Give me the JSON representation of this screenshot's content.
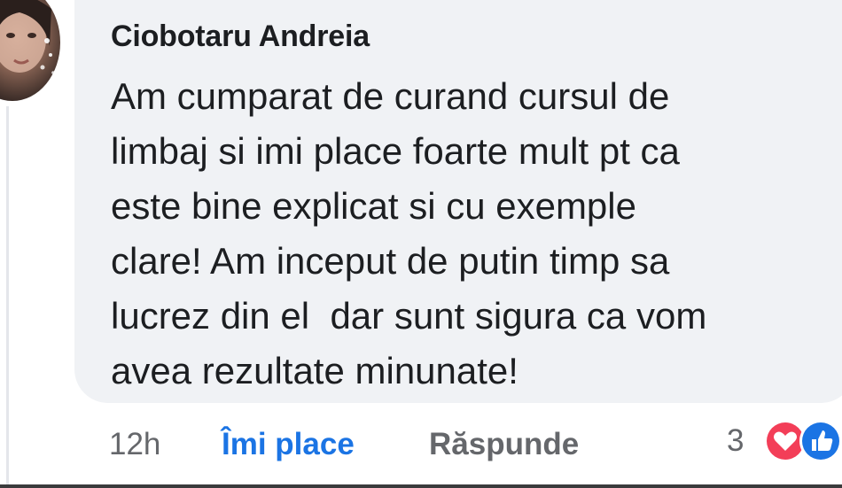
{
  "comment": {
    "author": "Ciobotaru Andreia",
    "text_lines": [
      "Am cumparat de curand cursul de",
      "limbaj si imi place foarte mult pt ca",
      "este bine explicat si cu exemple",
      "clare! Am inceput de putin timp sa",
      "lucrez din el  dar sunt sigura ca vom",
      "avea rezultate minunate!"
    ],
    "time": "12h",
    "like_label": "Îmi place",
    "reply_label": "Răspunde",
    "reaction_count": "3",
    "reaction_icons": [
      "love-reaction-icon",
      "like-reaction-icon"
    ]
  },
  "colors": {
    "bubble": "#f0f2f5",
    "like_blue": "#1b74e4",
    "muted": "#65676b",
    "love_red": "#f33e58"
  }
}
